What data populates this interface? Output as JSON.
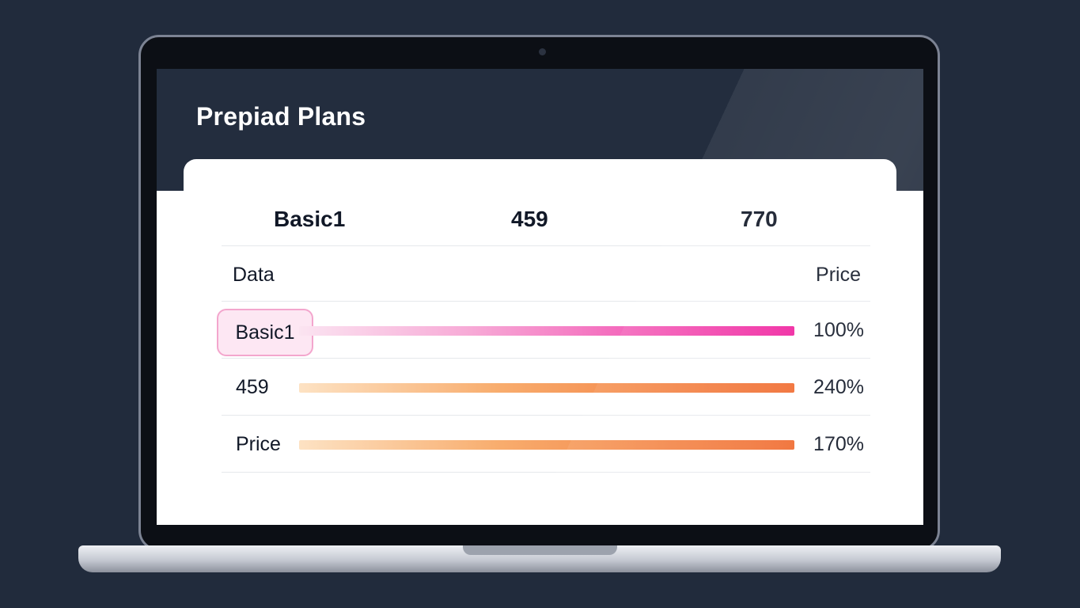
{
  "page_title": "Prepiad Plans",
  "table": {
    "header": [
      "Basic1",
      "459",
      "770"
    ],
    "subheader": {
      "left": "Data",
      "right": "Price"
    },
    "rows": [
      {
        "label": "Basic1",
        "value": "100%",
        "selected": true,
        "bar_color": "pink"
      },
      {
        "label": "459",
        "value": "240%",
        "selected": false,
        "bar_color": "orange"
      },
      {
        "label": "Price",
        "value": "170%",
        "selected": false,
        "bar_color": "orange"
      }
    ]
  },
  "colors": {
    "background": "#212b3c",
    "pink_accent": "#f0229f",
    "orange_accent": "#f06a2e"
  }
}
